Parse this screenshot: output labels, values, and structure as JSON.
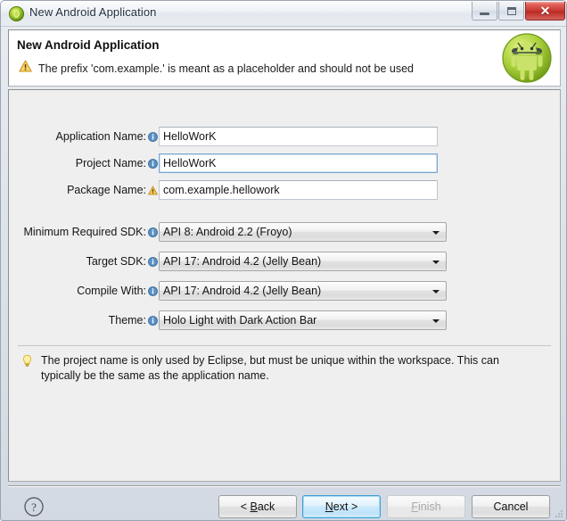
{
  "window": {
    "title": "New Android Application",
    "icon": "android-app-icon",
    "controls": {
      "minimize": "minimize-button",
      "maximize": "maximize-button",
      "close": "close-button",
      "close_glyph": "✕"
    }
  },
  "header": {
    "title": "New Android Application",
    "warning_icon": "warning-triangle-icon",
    "message": "The prefix 'com.example.' is meant as a placeholder and should not be used",
    "logo": "android-robot-logo"
  },
  "form": {
    "fields": [
      {
        "label": "Application Name:",
        "icon": "info-icon",
        "icon_type": "info",
        "type": "text",
        "value": "HelloWorK",
        "focused": false,
        "name": "application-name"
      },
      {
        "label": "Project Name:",
        "icon": "info-icon",
        "icon_type": "info",
        "type": "text",
        "value": "HelloWorK",
        "focused": true,
        "name": "project-name"
      },
      {
        "label": "Package Name:",
        "icon": "warning-icon",
        "icon_type": "warning",
        "type": "text",
        "value": "com.example.hellowork",
        "focused": false,
        "name": "package-name"
      }
    ],
    "combos": [
      {
        "label": "Minimum Required SDK:",
        "icon": "info-icon",
        "value": "API 8: Android 2.2 (Froyo)",
        "name": "minimum-required-sdk"
      },
      {
        "label": "Target SDK:",
        "icon": "info-icon",
        "value": "API 17: Android 4.2 (Jelly Bean)",
        "name": "target-sdk"
      },
      {
        "label": "Compile With:",
        "icon": "info-icon",
        "value": "API 17: Android 4.2 (Jelly Bean)",
        "name": "compile-with"
      },
      {
        "label": "Theme:",
        "icon": "info-icon",
        "value": "Holo Light with Dark Action Bar",
        "name": "theme"
      }
    ]
  },
  "tip": {
    "icon": "lightbulb-icon",
    "text": "The project name is only used by Eclipse, but must be unique within the workspace. This can typically be the same as the application name."
  },
  "buttons": {
    "help": "help-icon",
    "back": {
      "prefix": "< ",
      "mnemonic": "B",
      "rest": "ack"
    },
    "next": {
      "mnemonic": "N",
      "rest": "ext",
      "suffix": " >"
    },
    "finish": {
      "mnemonic": "F",
      "rest": "inish",
      "disabled": true
    },
    "cancel": {
      "label": "Cancel"
    }
  },
  "colors": {
    "accent": "#3c9fd6",
    "warning": "#f0a930",
    "info": "#3d7fb5",
    "android_green": "#a4c639",
    "close_red": "#c9352e"
  }
}
